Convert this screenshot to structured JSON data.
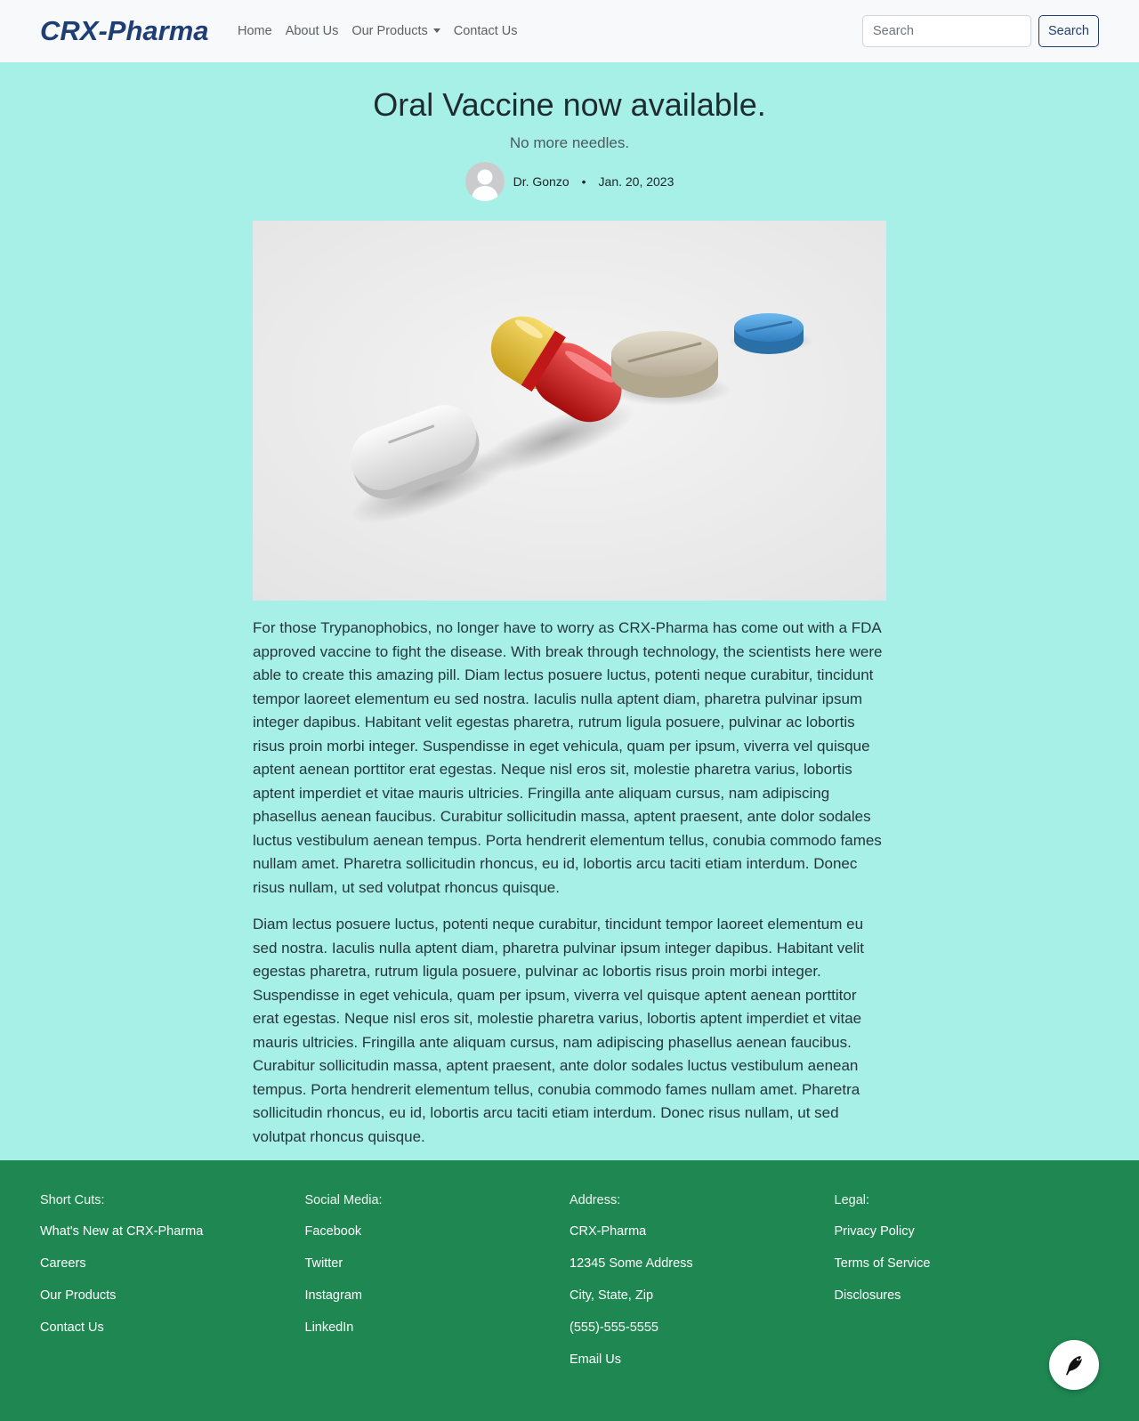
{
  "nav": {
    "brand": "CRX-Pharma",
    "links": [
      "Home",
      "About Us",
      "Our Products",
      "Contact Us"
    ],
    "search_placeholder": "Search",
    "search_button": "Search"
  },
  "article": {
    "title": "Oral Vaccine now available.",
    "subtitle": "No more needles.",
    "author": "Dr. Gonzo",
    "separator": "•",
    "date": "Jan. 20, 2023",
    "paragraphs": [
      "For those Trypanophobics, no longer have to worry as CRX-Pharma has come out with a FDA approved vaccine to fight the disease. With break through technology, the scientists here were able to create this amazing pill. Diam lectus posuere luctus, potenti neque curabitur, tincidunt tempor laoreet elementum eu sed nostra. Iaculis nulla aptent diam, pharetra pulvinar ipsum integer dapibus. Habitant velit egestas pharetra, rutrum ligula posuere, pulvinar ac lobortis risus proin morbi integer. Suspendisse in eget vehicula, quam per ipsum, viverra vel quisque aptent aenean porttitor erat egestas. Neque nisl eros sit, molestie pharetra varius, lobortis aptent imperdiet et vitae mauris ultricies. Fringilla ante aliquam cursus, nam adipiscing phasellus aenean faucibus. Curabitur sollicitudin massa, aptent praesent, ante dolor sodales luctus vestibulum aenean tempus. Porta hendrerit elementum tellus, conubia commodo fames nullam amet. Pharetra sollicitudin rhoncus, eu id, lobortis arcu taciti etiam interdum. Donec risus nullam, ut sed volutpat rhoncus quisque.",
      "Diam lectus posuere luctus, potenti neque curabitur, tincidunt tempor laoreet elementum eu sed nostra. Iaculis nulla aptent diam, pharetra pulvinar ipsum integer dapibus. Habitant velit egestas pharetra, rutrum ligula posuere, pulvinar ac lobortis risus proin morbi integer. Suspendisse in eget vehicula, quam per ipsum, viverra vel quisque aptent aenean porttitor erat egestas. Neque nisl eros sit, molestie pharetra varius, lobortis aptent imperdiet et vitae mauris ultricies. Fringilla ante aliquam cursus, nam adipiscing phasellus aenean faucibus. Curabitur sollicitudin massa, aptent praesent, ante dolor sodales luctus vestibulum aenean tempus. Porta hendrerit elementum tellus, conubia commodo fames nullam amet. Pharetra sollicitudin rhoncus, eu id, lobortis arcu taciti etiam interdum. Donec risus nullam, ut sed volutpat rhoncus quisque."
    ]
  },
  "footer": {
    "columns": [
      {
        "heading": "Short Cuts:",
        "items": [
          "What's New at CRX-Pharma",
          "Careers",
          "Our Products",
          "Contact Us"
        ]
      },
      {
        "heading": "Social Media:",
        "items": [
          "Facebook",
          "Twitter",
          "Instagram",
          "LinkedIn"
        ]
      },
      {
        "heading": "Address:",
        "items": [
          "CRX-Pharma",
          "12345 Some Address",
          "City, State, Zip",
          "(555)-555-5555",
          "Email Us"
        ]
      },
      {
        "heading": "Legal:",
        "items": [
          "Privacy Policy",
          "Terms of Service",
          "Disclosures"
        ]
      }
    ]
  },
  "colors": {
    "page_bg": "#a6f0e8",
    "navbar_bg": "#f8f9fa",
    "brand": "#1f3e73",
    "footer_bg": "#1f8752"
  },
  "icons": {
    "avatar": "user-avatar-icon",
    "fab": "quill-pen-icon"
  }
}
